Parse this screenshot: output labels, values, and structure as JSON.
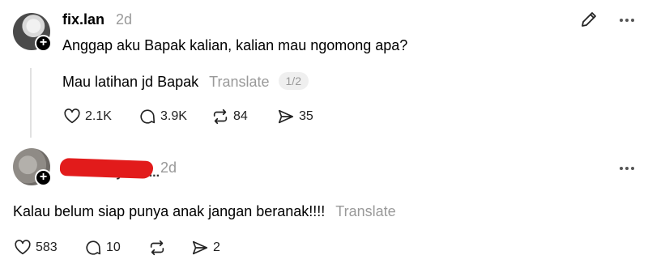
{
  "post1": {
    "username": "fix.lan",
    "time": "2d",
    "text": "Anggap aku Bapak kalian, kalian mau ngomong apa?",
    "reply": {
      "text": "Mau latihan jd Bapak",
      "translate_label": "Translate",
      "pager": "1/2"
    },
    "actions": {
      "likes": "2.1K",
      "comments": "3.9K",
      "reposts": "84",
      "shares": "35"
    }
  },
  "post2": {
    "username_partial": "...ny.and...",
    "time": "2d",
    "text": "Kalau belum siap punya anak jangan beranak!!!!",
    "translate_label": "Translate",
    "actions": {
      "likes": "583",
      "comments": "10",
      "reposts": "",
      "shares": "2"
    }
  },
  "icons": {
    "like": "heart-icon",
    "comment": "comment-icon",
    "repost": "repost-icon",
    "share": "share-icon",
    "edit": "pencil-icon",
    "more": "more-icon",
    "follow": "plus-icon"
  }
}
